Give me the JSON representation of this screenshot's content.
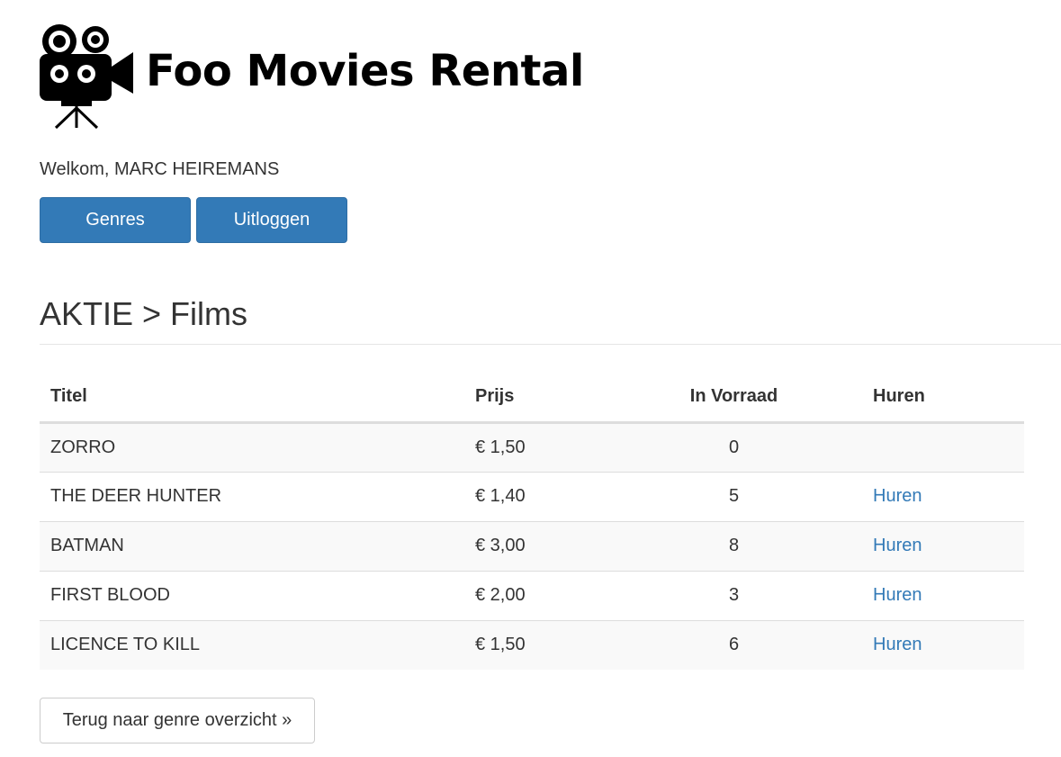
{
  "brand": {
    "name": "Foo Movies Rental",
    "logo_icon": "movie-camera-icon"
  },
  "welcome": {
    "prefix": "Welkom, ",
    "user": "MARC HEIREMANS"
  },
  "nav": {
    "genres_label": "Genres",
    "logout_label": "Uitloggen"
  },
  "page": {
    "heading": "AKTIE > Films"
  },
  "table": {
    "headers": {
      "title": "Titel",
      "price": "Prijs",
      "stock": "In Vorraad",
      "rent": "Huren"
    },
    "rows": [
      {
        "title": "ZORRO",
        "price": "€ 1,50",
        "stock": "0",
        "rent": ""
      },
      {
        "title": "THE DEER HUNTER",
        "price": "€ 1,40",
        "stock": "5",
        "rent": "Huren"
      },
      {
        "title": "BATMAN",
        "price": "€ 3,00",
        "stock": "8",
        "rent": "Huren"
      },
      {
        "title": "FIRST BLOOD",
        "price": "€ 2,00",
        "stock": "3",
        "rent": "Huren"
      },
      {
        "title": "LICENCE TO KILL",
        "price": "€ 1,50",
        "stock": "6",
        "rent": "Huren"
      }
    ]
  },
  "footer": {
    "back_label": "Terug naar genre overzicht »"
  },
  "colors": {
    "primary": "#337ab7",
    "link": "#337ab7",
    "striped_row": "#f9f9f9"
  }
}
